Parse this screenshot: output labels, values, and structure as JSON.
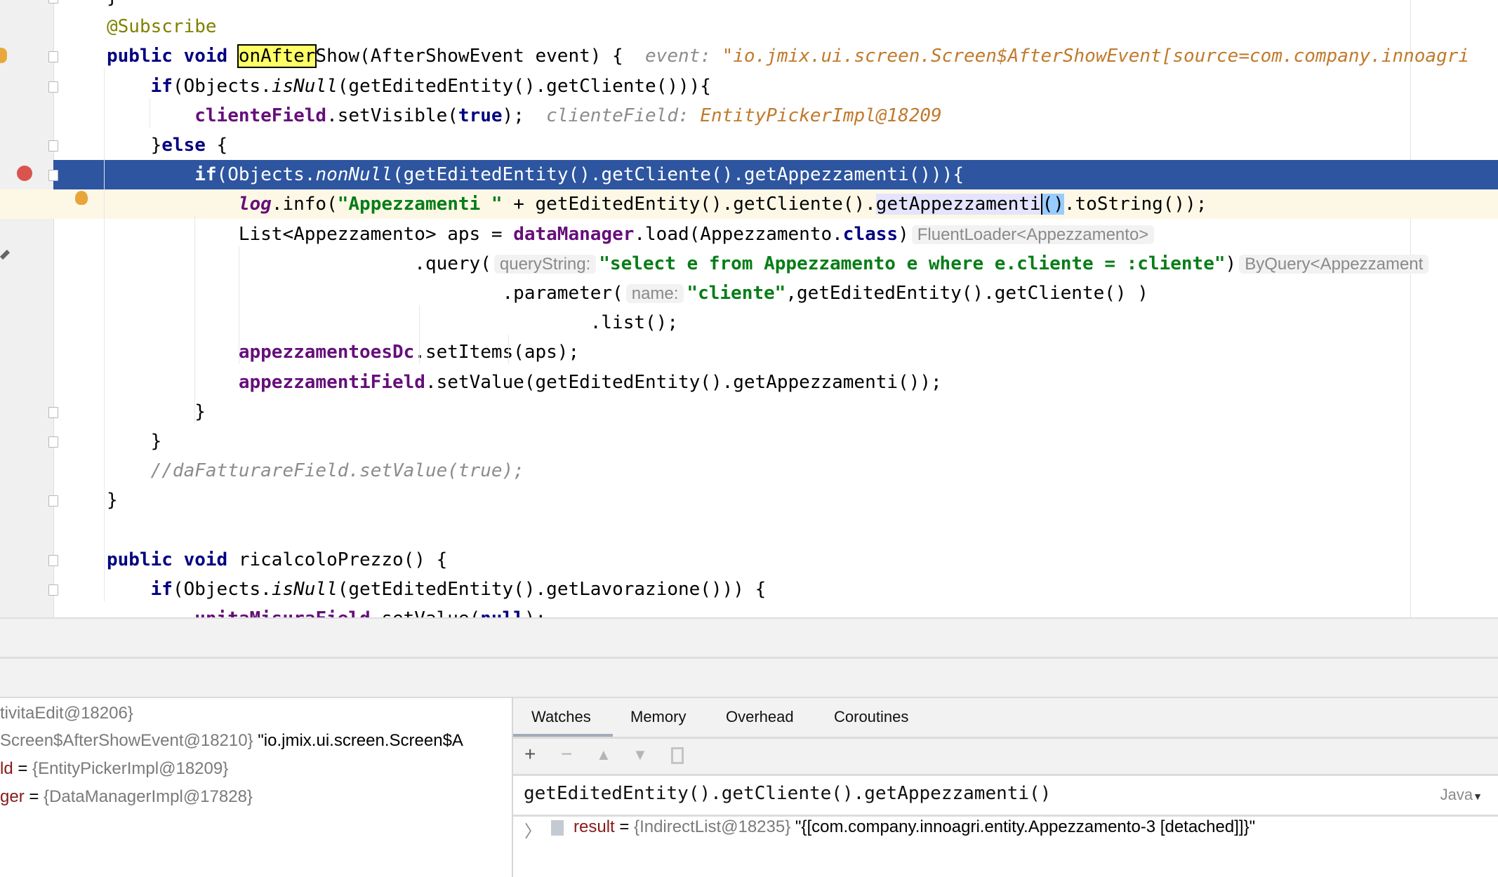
{
  "editor": {
    "lines": [
      {
        "tokens": [
          [
            "p",
            "}"
          ]
        ]
      },
      {
        "tokens": [
          [
            "a",
            "@Subscribe"
          ]
        ]
      },
      {
        "tokens": [
          [
            "k",
            "public void "
          ],
          [
            "hl",
            "onAfter"
          ],
          [
            "p",
            "Show(AfterShowEvent event) {  "
          ],
          [
            "h",
            "event: "
          ],
          [
            "v",
            "\"io.jmix.ui.screen.Screen$AfterShowEvent[source=com.company.innoagri"
          ]
        ]
      },
      {
        "tokens": [
          [
            "p",
            "    "
          ],
          [
            "k",
            "if"
          ],
          [
            "p",
            "(Objects."
          ],
          [
            "it",
            "isNull"
          ],
          [
            "p",
            "(getEditedEntity().getCliente())){"
          ]
        ]
      },
      {
        "tokens": [
          [
            "p",
            "        "
          ],
          [
            "f",
            "clienteField"
          ],
          [
            "p",
            ".setVisible("
          ],
          [
            "k",
            "true"
          ],
          [
            "p",
            ");  "
          ],
          [
            "h",
            "clienteField: "
          ],
          [
            "v",
            "EntityPickerImpl@18209"
          ]
        ]
      },
      {
        "tokens": [
          [
            "p",
            "    }"
          ],
          [
            "k",
            "else"
          ],
          [
            "p",
            " {"
          ]
        ]
      },
      {
        "tokens": [
          [
            "p",
            "        "
          ],
          [
            "k",
            "if"
          ],
          [
            "p",
            "(Objects."
          ],
          [
            "it",
            "nonNull"
          ],
          [
            "p",
            "(getEditedEntity().getCliente().getAppezzamenti())){"
          ]
        ]
      },
      {
        "tokens": [
          [
            "p",
            "            "
          ],
          [
            "fi",
            "log"
          ],
          [
            "p",
            ".info("
          ],
          [
            "s",
            "\"Appezzamenti \""
          ],
          [
            "p",
            " + getEditedEntity().getCliente()."
          ],
          [
            "sel",
            "getAppezzamenti"
          ],
          [
            "br",
            "()"
          ],
          [
            "p",
            ".toString());"
          ]
        ]
      },
      {
        "tokens": [
          [
            "p",
            "            List<Appezzamento> aps = "
          ],
          [
            "f",
            "dataManager"
          ],
          [
            "p",
            ".load(Appezzamento."
          ],
          [
            "k",
            "class"
          ],
          [
            "p",
            ")"
          ],
          [
            "box",
            "FluentLoader<Appezzamento>"
          ]
        ]
      },
      {
        "tokens": [
          [
            "p",
            "                            .query("
          ],
          [
            "box",
            "queryString:"
          ],
          [
            "s",
            "\"select e from Appezzamento e where e.cliente = :cliente\""
          ],
          [
            "p",
            ")"
          ],
          [
            "box",
            "ByQuery<Appezzament"
          ]
        ]
      },
      {
        "tokens": [
          [
            "p",
            "                                    .parameter("
          ],
          [
            "box",
            "name:"
          ],
          [
            "s",
            "\"cliente\""
          ],
          [
            "p",
            ",getEditedEntity().getCliente() )"
          ]
        ]
      },
      {
        "tokens": [
          [
            "p",
            "                                            .list();"
          ]
        ]
      },
      {
        "tokens": [
          [
            "p",
            "            "
          ],
          [
            "f",
            "appezzamentoesDc"
          ],
          [
            "p",
            ".setItems(aps);"
          ]
        ]
      },
      {
        "tokens": [
          [
            "p",
            "            "
          ],
          [
            "f",
            "appezzamentiField"
          ],
          [
            "p",
            ".setValue(getEditedEntity().getAppezzamenti());"
          ]
        ]
      },
      {
        "tokens": [
          [
            "p",
            "        }"
          ]
        ]
      },
      {
        "tokens": [
          [
            "p",
            "    }"
          ]
        ]
      },
      {
        "tokens": [
          [
            "p",
            "    "
          ],
          [
            "c",
            "//daFatturareField.setValue(true);"
          ]
        ]
      },
      {
        "tokens": [
          [
            "p",
            "}"
          ]
        ]
      },
      {
        "tokens": []
      },
      {
        "tokens": [
          [
            "k",
            "public void "
          ],
          [
            "p",
            "ricalcoloPrezzo() {"
          ]
        ]
      },
      {
        "tokens": [
          [
            "p",
            "    "
          ],
          [
            "k",
            "if"
          ],
          [
            "p",
            "(Objects."
          ],
          [
            "it",
            "isNull"
          ],
          [
            "p",
            "(getEditedEntity().getLavorazione())) {"
          ]
        ]
      },
      {
        "tokens": [
          [
            "p",
            "        "
          ],
          [
            "f",
            "unitaMisuraField"
          ],
          [
            "p",
            ".setValue("
          ],
          [
            "k",
            "null"
          ],
          [
            "p",
            ");"
          ]
        ]
      }
    ],
    "selected_line": 6,
    "current_line": 7,
    "colors": {
      "selection": "#2d55a0",
      "current_line": "#fdf8e6",
      "keyword": "#000080",
      "field": "#660e7a",
      "string": "#067d17"
    }
  },
  "variables": [
    {
      "value": "tivitaEdit@18206}"
    },
    {
      "value": "Screen$AfterShowEvent@18210}",
      "extra": " \"io.jmix.ui.screen.Screen$A"
    },
    {
      "name": "ld",
      "eq": " = ",
      "value": "{EntityPickerImpl@18209}"
    },
    {
      "name": "ger",
      "eq": " = ",
      "value": "{DataManagerImpl@17828}"
    }
  ],
  "watches": {
    "tabs": [
      "Watches",
      "Memory",
      "Overhead",
      "Coroutines"
    ],
    "active_tab": "Watches",
    "toolbar": [
      "add-icon",
      "remove-icon",
      "move-up-icon",
      "move-down-icon",
      "duplicate-icon"
    ],
    "expression": "getEditedEntity().getCliente().getAppezzamenti()",
    "language": "Java",
    "result": {
      "name": "result",
      "eq": " = ",
      "ref": "{IndirectList@18235}",
      "value": " \"{[com.company.innoagri.entity.Appezzamento-3 [detached]]}\""
    }
  }
}
